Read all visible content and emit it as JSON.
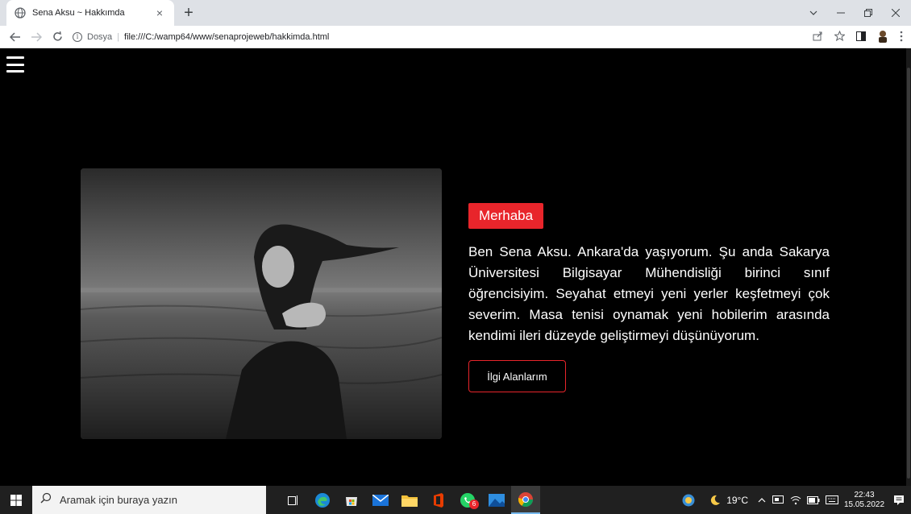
{
  "browser": {
    "tab_title": "Sena Aksu ~ Hakkımda",
    "tab_close": "×",
    "new_tab": "+",
    "address_scheme": "Dosya",
    "address_url": "file:///C:/wamp64/www/senaprojeweb/hakkimda.html"
  },
  "page": {
    "badge": "Merhaba",
    "bio": "Ben Sena Aksu. Ankara'da yaşıyorum. Şu anda Sakarya Üniversitesi Bilgisayar Mühendisliği birinci sınıf öğrencisiyim. Seyahat etmeyi yeni yerler keşfetmeyi çok severim. Masa tenisi oynamak yeni hobilerim arasında kendimi ileri düzeyde geliştirmeyi düşünüyorum.",
    "button": "İlgi Alanlarım"
  },
  "taskbar": {
    "search_placeholder": "Aramak için buraya yazın",
    "badge_count": "6",
    "temperature": "19°C",
    "time": "22:43",
    "date": "15.05.2022"
  },
  "colors": {
    "accent": "#e8252b",
    "background": "#000000",
    "taskbar": "#202020"
  }
}
